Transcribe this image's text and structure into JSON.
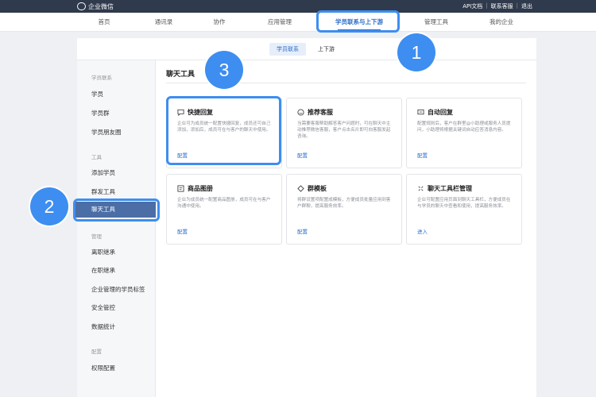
{
  "brand": {
    "name": "企业微信"
  },
  "top_links": [
    "API文档",
    "联系客服",
    "退出"
  ],
  "nav": [
    {
      "label": "首页",
      "active": false
    },
    {
      "label": "通讯录",
      "active": false
    },
    {
      "label": "协作",
      "active": false
    },
    {
      "label": "应用管理",
      "active": false
    },
    {
      "label": "学员联系与上下游",
      "active": true
    },
    {
      "label": "管理工具",
      "active": false
    },
    {
      "label": "我的企业",
      "active": false
    }
  ],
  "subtabs": [
    {
      "label": "学员联系",
      "active": true
    },
    {
      "label": "上下游",
      "active": false
    }
  ],
  "sidebar": {
    "groups": [
      {
        "title": "学员联系",
        "items": [
          {
            "label": "学员",
            "active": false
          },
          {
            "label": "学员群",
            "active": false
          },
          {
            "label": "学员朋友圈",
            "active": false
          }
        ]
      },
      {
        "title": "工具",
        "items": [
          {
            "label": "添加学员",
            "active": false
          },
          {
            "label": "群发工具",
            "active": false
          },
          {
            "label": "聊天工具",
            "active": true
          }
        ]
      },
      {
        "title": "管理",
        "items": [
          {
            "label": "离职继承",
            "active": false
          },
          {
            "label": "在职继承",
            "active": false
          },
          {
            "label": "企业管理的学员标签",
            "active": false
          },
          {
            "label": "安全管控",
            "active": false
          },
          {
            "label": "数据统计",
            "active": false
          }
        ]
      },
      {
        "title": "配置",
        "items": [
          {
            "label": "权限配置",
            "active": false
          }
        ]
      }
    ]
  },
  "content": {
    "title": "聊天工具",
    "cards": [
      {
        "icon": "chat-bubble-icon",
        "title": "快捷回复",
        "desc": "企业可为成员统一配置快捷回复，成员还可自己添加，添加后，成员可在与客户的聊天中使用。",
        "link": "配置"
      },
      {
        "icon": "service-icon",
        "title": "推荐客服",
        "desc": "当需要客服帮助解答客户问题时，可在聊天中主动推荐微信客服，客户点击名片即可向客服发起咨询。",
        "link": "配置"
      },
      {
        "icon": "auto-reply-icon",
        "title": "自动回复",
        "desc": "配置规则后，客户在群里@小助理或服务人员提问，小助理将根据关键词自动应答消息内容。",
        "link": "配置"
      },
      {
        "icon": "image-album-icon",
        "title": "商品图册",
        "desc": "企业为成员统一配置商品图册，成员可在与客户沟通中使用。",
        "link": "配置"
      },
      {
        "icon": "template-icon",
        "title": "群模板",
        "desc": "将群设置项配置成模板，方便成员批量应用到客户群聊，提高服务效率。",
        "link": "配置"
      },
      {
        "icon": "toolbar-icon",
        "title": "聊天工具栏管理",
        "desc": "企业可配置应用页面到聊天工具栏，方便成员在与学员的聊天中查看和使用，提高服务效率。",
        "link": "进入"
      }
    ]
  },
  "annotations": [
    "1",
    "2",
    "3"
  ],
  "colors": {
    "accent": "#2b6ec8",
    "highlight": "#3d8ef0",
    "topbar": "#2f3a4c",
    "sidebar_active": "#4b6ea6"
  }
}
